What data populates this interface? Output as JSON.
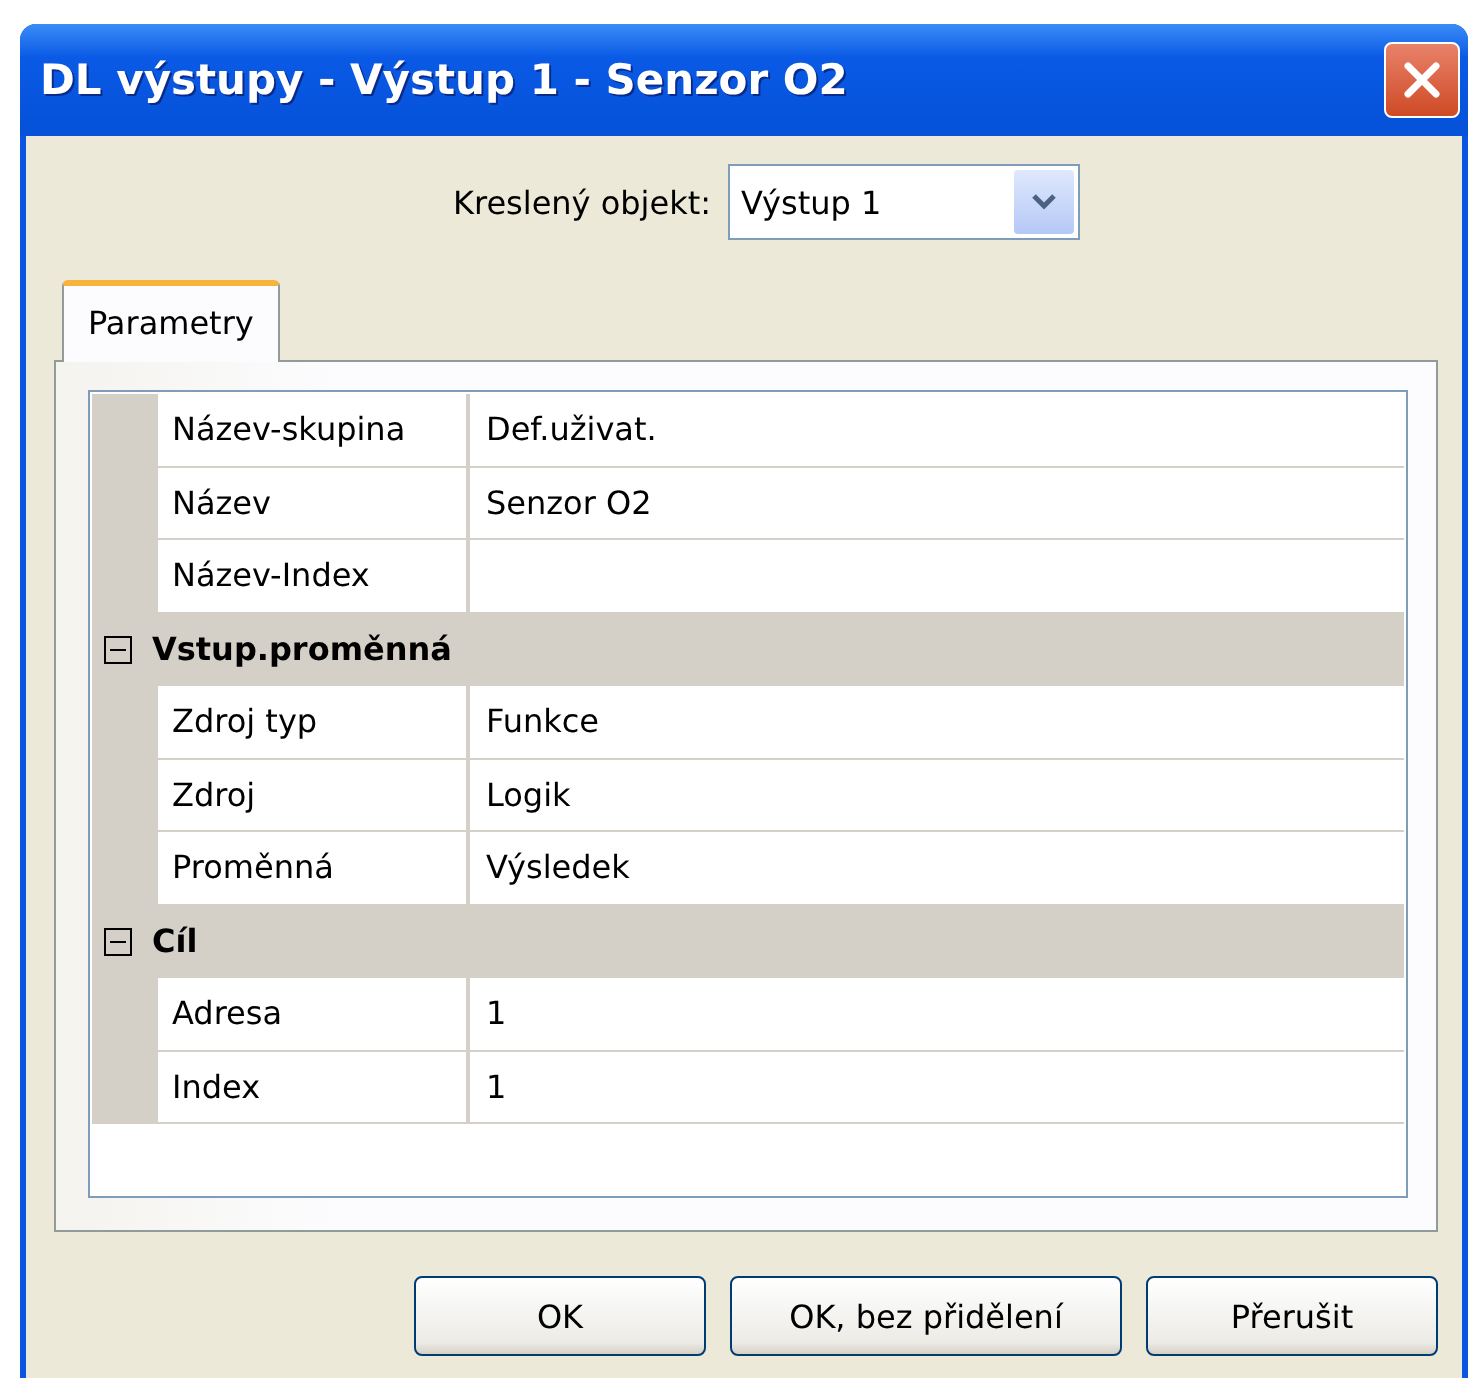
{
  "window": {
    "title": "DL výstupy - Výstup 1 - Senzor O2"
  },
  "drawn_object": {
    "label": "Kreslený objekt:",
    "value": "Výstup 1"
  },
  "tabs": [
    {
      "label": "Parametry",
      "selected": true
    }
  ],
  "grid": {
    "rows": [
      {
        "kind": "property",
        "name": "Název-skupina",
        "value": "Def.uživat."
      },
      {
        "kind": "property",
        "name": "Název",
        "value": "Senzor O2"
      },
      {
        "kind": "property",
        "name": "Název-Index"
      },
      {
        "kind": "category",
        "name": "Vstup.proměnná",
        "expanded": true
      },
      {
        "kind": "property",
        "name": "Zdroj typ",
        "value": "Funkce"
      },
      {
        "kind": "property",
        "name": "Zdroj",
        "value": "Logik"
      },
      {
        "kind": "property",
        "name": "Proměnná",
        "value": "Výsledek"
      },
      {
        "kind": "category",
        "name": "Cíl",
        "expanded": true
      },
      {
        "kind": "property",
        "name": "Adresa",
        "value": "1"
      },
      {
        "kind": "property",
        "name": "Index",
        "value": "1"
      }
    ]
  },
  "buttons": [
    "OK",
    "OK, bez přidělení",
    "Přerušit"
  ]
}
